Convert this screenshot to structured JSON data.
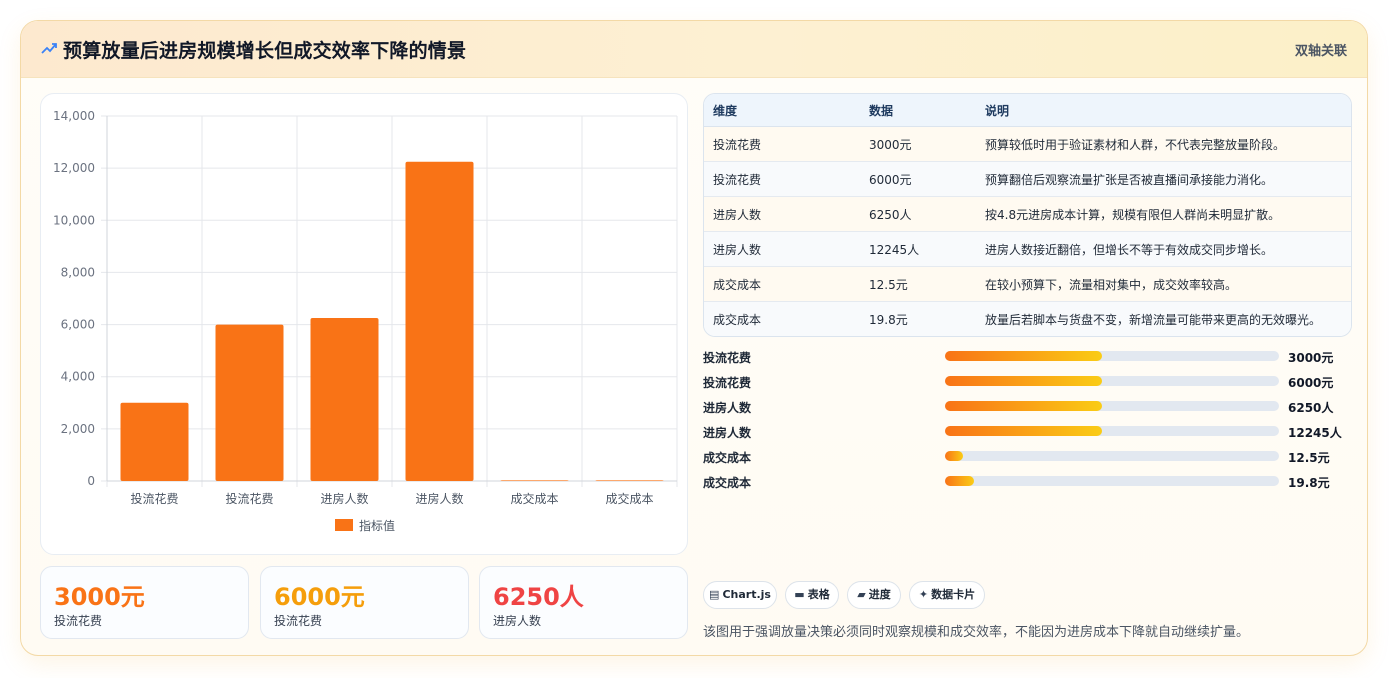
{
  "header": {
    "icon": "trend-icon",
    "title": "预算放量后进房规模增长但成交效率下降的情景",
    "tag": "双轴关联"
  },
  "chart_data": {
    "type": "bar",
    "categories": [
      "投流花费",
      "投流花费",
      "进房人数",
      "进房人数",
      "成交成本",
      "成交成本"
    ],
    "series": [
      {
        "name": "指标值",
        "values": [
          3000,
          6000,
          6250,
          12245,
          12.5,
          19.8
        ]
      }
    ],
    "ylim": [
      0,
      14000
    ],
    "yticks": [
      "0",
      "2,000",
      "4,000",
      "6,000",
      "8,000",
      "10,000",
      "12,000",
      "14,000"
    ],
    "legend": "bottom",
    "grid": true,
    "color": "#f97316"
  },
  "stats": [
    {
      "value": "3000元",
      "label": "投流花费",
      "color": "#f97316"
    },
    {
      "value": "6000元",
      "label": "投流花费",
      "color": "#f59e0b"
    },
    {
      "value": "6250人",
      "label": "进房人数",
      "color": "#ef4444"
    }
  ],
  "table": {
    "headers": [
      "维度",
      "数据",
      "说明"
    ],
    "rows": [
      [
        "投流花费",
        "3000元",
        "预算较低时用于验证素材和人群，不代表完整放量阶段。"
      ],
      [
        "投流花费",
        "6000元",
        "预算翻倍后观察流量扩张是否被直播间承接能力消化。"
      ],
      [
        "进房人数",
        "6250人",
        "按4.8元进房成本计算，规模有限但人群尚未明显扩散。"
      ],
      [
        "进房人数",
        "12245人",
        "进房人数接近翻倍，但增长不等于有效成交同步增长。"
      ],
      [
        "成交成本",
        "12.5元",
        "在较小预算下，流量相对集中，成交效率较高。"
      ],
      [
        "成交成本",
        "19.8元",
        "放量后若脚本与货盘不变，新增流量可能带来更高的无效曝光。"
      ]
    ]
  },
  "progress": [
    {
      "label": "投流花费",
      "value": "3000元",
      "fill": 0.47
    },
    {
      "label": "投流花费",
      "value": "6000元",
      "fill": 0.47
    },
    {
      "label": "进房人数",
      "value": "6250人",
      "fill": 0.47
    },
    {
      "label": "进房人数",
      "value": "12245人",
      "fill": 0.47
    },
    {
      "label": "成交成本",
      "value": "12.5元",
      "fill": 0.055
    },
    {
      "label": "成交成本",
      "value": "19.8元",
      "fill": 0.088
    }
  ],
  "chips": [
    {
      "icon": "chart-icon",
      "label": "Chart.js"
    },
    {
      "icon": "table-icon",
      "label": "表格"
    },
    {
      "icon": "progress-icon",
      "label": "进度"
    },
    {
      "icon": "sparkle-icon",
      "label": "数据卡片"
    }
  ],
  "description": "该图用于强调放量决策必须同时观察规模和成交效率，不能因为进房成本下降就自动继续扩量。"
}
